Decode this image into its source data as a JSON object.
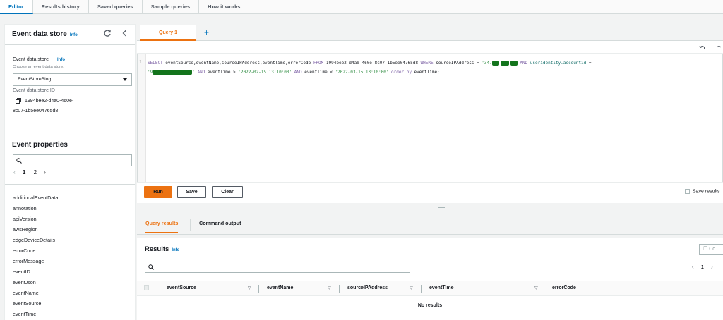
{
  "top_tabs": [
    "Editor",
    "Results history",
    "Saved queries",
    "Sample queries",
    "How it works"
  ],
  "left_panel": {
    "title": "Event data store",
    "info": "Info",
    "store_label": "Event data store",
    "store_info": "Info",
    "store_hint": "Choose an event data store.",
    "store_selected": "EventStoreBlog",
    "store_id_label": "Event data store ID",
    "store_id_line1": "1994bee2-d4a0-460e-",
    "store_id_line2": "8c07-1b5ee04765d8",
    "props_title": "Event properties",
    "pages": [
      "1",
      "2"
    ],
    "properties": [
      "additionalEventData",
      "annotation",
      "apiVersion",
      "awsRegion",
      "edgeDeviceDetails",
      "errorCode",
      "errorMessage",
      "eventID",
      "eventJson",
      "eventName",
      "eventSource",
      "eventTime"
    ]
  },
  "editor": {
    "tab": "Query 1",
    "line_no": "1",
    "q": {
      "select": "SELECT",
      "fields": " eventSource,eventName,sourceIPAddress,eventTime,errorCode ",
      "from": "FROM",
      "store": " 1994bee2-d4a0-460e-8c07-1b5ee04765d8 ",
      "where": "WHERE",
      "ip_field": " sourceIPAddress = ",
      "ip_start": "'34.",
      "and1": " AND ",
      "acct_field": "useridentity.accountid",
      "eq": " =",
      "acct_start": "'9",
      "acct_end": "'",
      "and2": " AND ",
      "evt_gt": "eventTime > ",
      "date1": "'2022-02-15 13:10:00'",
      "and3": " AND ",
      "evt_lt": "eventTime < ",
      "date2": "'2022-03-15 13:10:00'",
      "order": " order by",
      "tail": " eventTime;"
    },
    "run": "Run",
    "save": "Save",
    "clear": "Clear",
    "save_results": "Save results"
  },
  "results": {
    "tabs": [
      "Query results",
      "Command output"
    ],
    "title": "Results",
    "info": "Info",
    "copy": "Co",
    "page": "1",
    "columns": [
      "eventSource",
      "eventName",
      "sourceIPAddress",
      "eventTime",
      "errorCode"
    ],
    "empty": "No results"
  },
  "colors": {
    "accent": "#ec7211",
    "link": "#0073bb",
    "redaction": "#13741c"
  }
}
